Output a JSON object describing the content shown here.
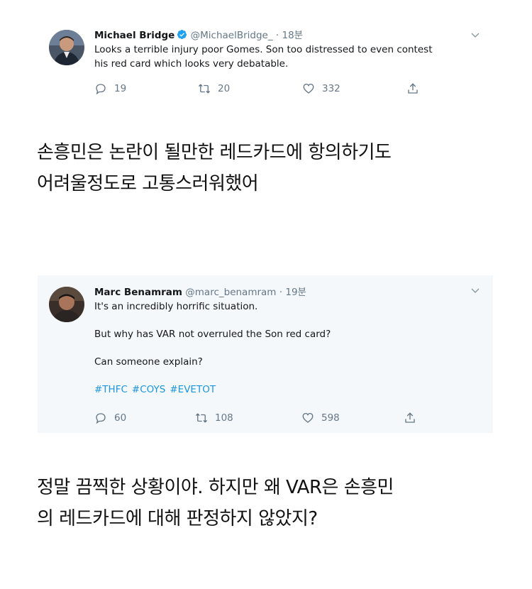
{
  "tweets": [
    {
      "name": "Michael Bridge",
      "handle": "@MichaelBridge_",
      "separator": "·",
      "time": "18분",
      "verified": true,
      "text_lines": [
        "Looks a terrible injury poor Gomes. Son too distressed to even contest",
        "his red card which looks very debatable."
      ],
      "replies": "19",
      "retweets": "20",
      "likes": "332"
    },
    {
      "name": "Marc Benamram",
      "handle": "@marc_benamram",
      "separator": "·",
      "time": "19분",
      "verified": false,
      "paragraphs": [
        "It's an incredibly horrific situation.",
        "But why has VAR not overruled the Son red card?",
        "Can someone explain?"
      ],
      "hashtags": [
        "#THFC",
        "#COYS",
        "#EVETOT"
      ],
      "replies": "60",
      "retweets": "108",
      "likes": "598"
    }
  ],
  "captions": [
    [
      "손흥민은 논란이 될만한 레드카드에 항의하기도",
      "어려울정도로 고통스러워했어"
    ],
    [
      "정말 끔찍한 상황이야. 하지만 왜 VAR은 손흥민",
      "의 레드카드에 대해 판정하지 않았지?"
    ]
  ],
  "colors": {
    "accent": "#1b95e0",
    "muted": "#657786",
    "tweet2_bg": "#f5f8fa"
  },
  "icons": [
    "reply-icon",
    "retweet-icon",
    "like-icon",
    "share-icon",
    "chevron-down-icon",
    "verified-badge-icon"
  ]
}
